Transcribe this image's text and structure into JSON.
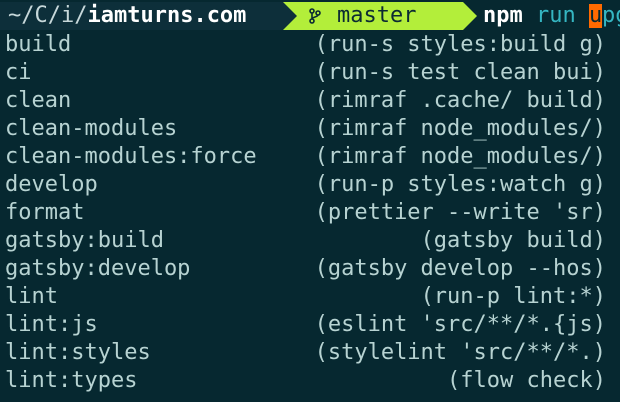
{
  "prompt": {
    "path": "~/C/i/",
    "repo": "iamturns.com",
    "branch": "master",
    "command_npm": "npm",
    "command_run": "run",
    "cursor_char": "u",
    "typed_rest": "pg"
  },
  "scripts": [
    {
      "name": "build",
      "description": "(run-s styles:build g)"
    },
    {
      "name": "ci",
      "description": "(run-s test clean bui)"
    },
    {
      "name": "clean",
      "description": "(rimraf .cache/ build)"
    },
    {
      "name": "clean-modules",
      "description": "(rimraf node_modules/)"
    },
    {
      "name": "clean-modules:force",
      "description": "(rimraf node_modules/)"
    },
    {
      "name": "develop",
      "description": "(run-p styles:watch g)"
    },
    {
      "name": "format",
      "description": "(prettier --write 'sr)"
    },
    {
      "name": "gatsby:build",
      "description": "(gatsby build)"
    },
    {
      "name": "gatsby:develop",
      "description": "(gatsby develop --hos)"
    },
    {
      "name": "lint",
      "description": "(run-p lint:*)"
    },
    {
      "name": "lint:js",
      "description": "(eslint 'src/**/*.{js)"
    },
    {
      "name": "lint:styles",
      "description": "(stylelint 'src/**/*.)"
    },
    {
      "name": "lint:types",
      "description": "(flow check)"
    }
  ],
  "colors": {
    "background": "#062830",
    "text": "#b7d3d2",
    "branch_segment": "#b3ee3a",
    "cursor": "#ff6a00",
    "command_accent": "#35b6c2"
  }
}
